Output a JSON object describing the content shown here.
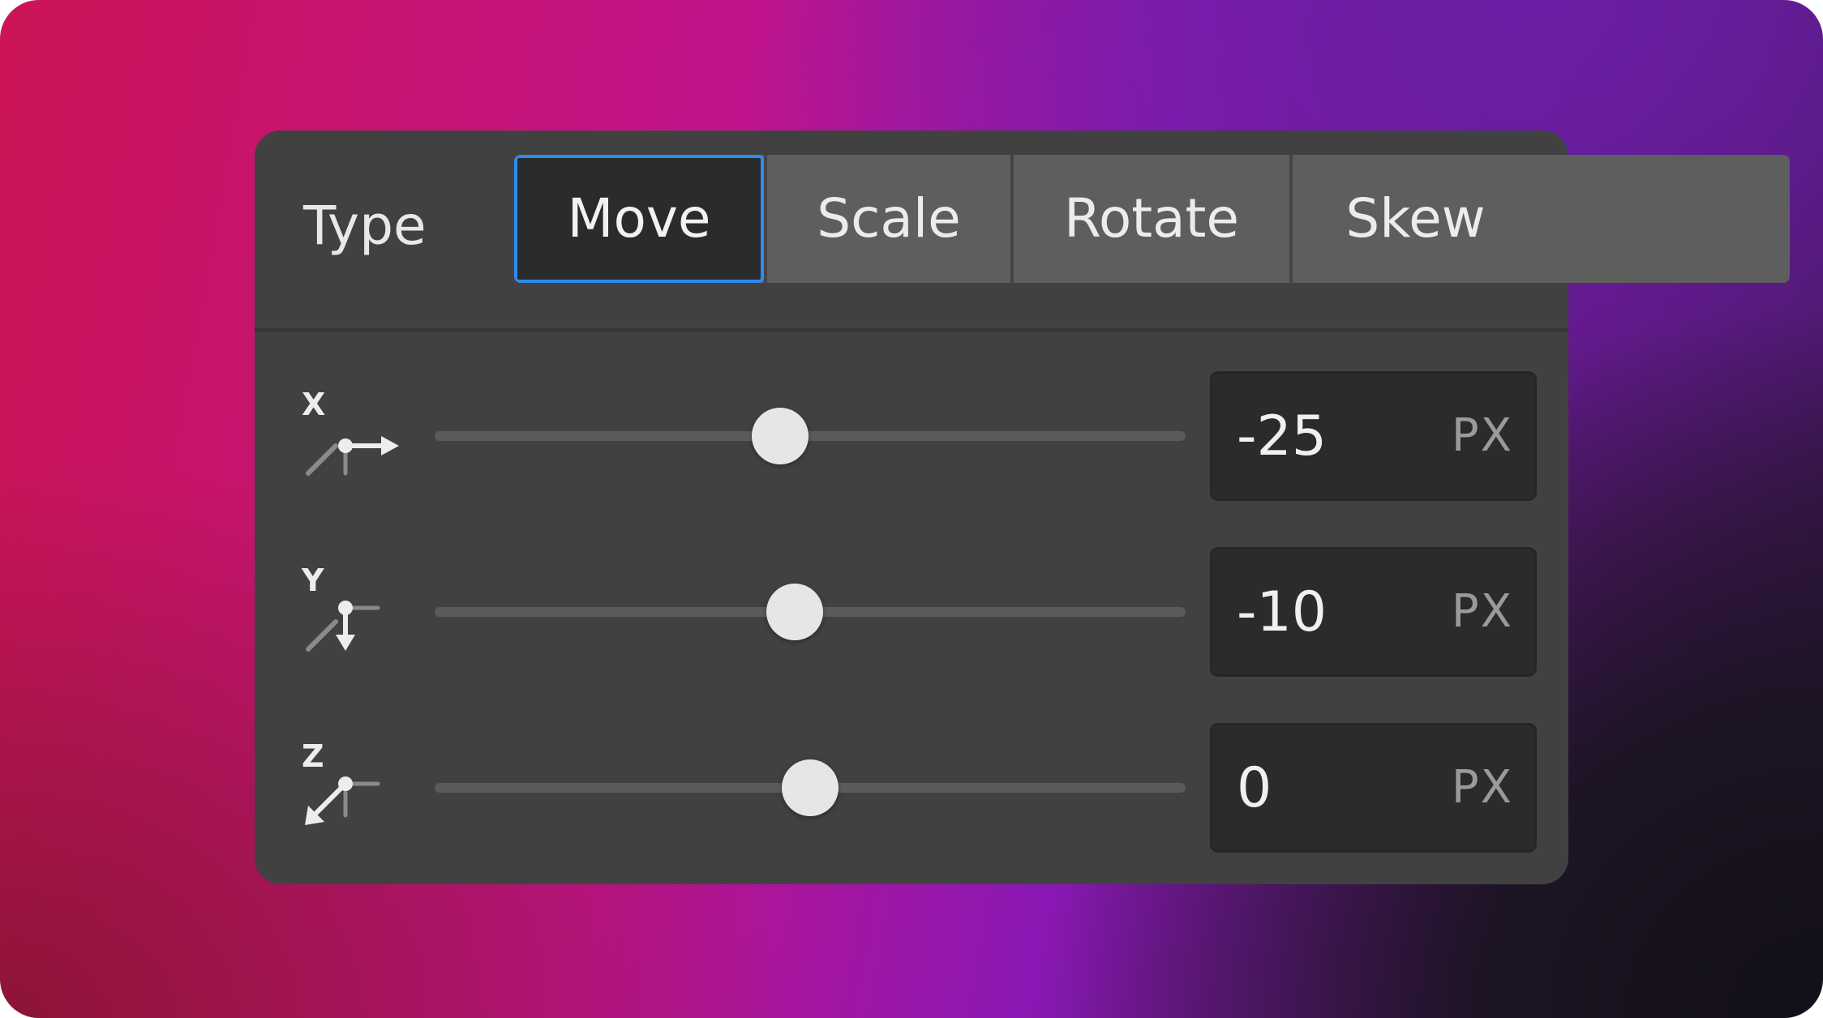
{
  "type_row": {
    "label": "Type",
    "options": [
      "Move",
      "Scale",
      "Rotate",
      "Skew"
    ],
    "selected": "Move"
  },
  "axes": [
    {
      "axis": "X",
      "icon": "move-x-axis-icon",
      "value": "-25",
      "unit": "PX",
      "slider_fraction": 0.46
    },
    {
      "axis": "Y",
      "icon": "move-y-axis-icon",
      "value": "-10",
      "unit": "PX",
      "slider_fraction": 0.48
    },
    {
      "axis": "Z",
      "icon": "move-z-axis-icon",
      "value": "0",
      "unit": "PX",
      "slider_fraction": 0.5
    }
  ],
  "colors": {
    "panel": "#414141",
    "accent": "#2d8cf0",
    "thumb": "#e6e6e6"
  }
}
